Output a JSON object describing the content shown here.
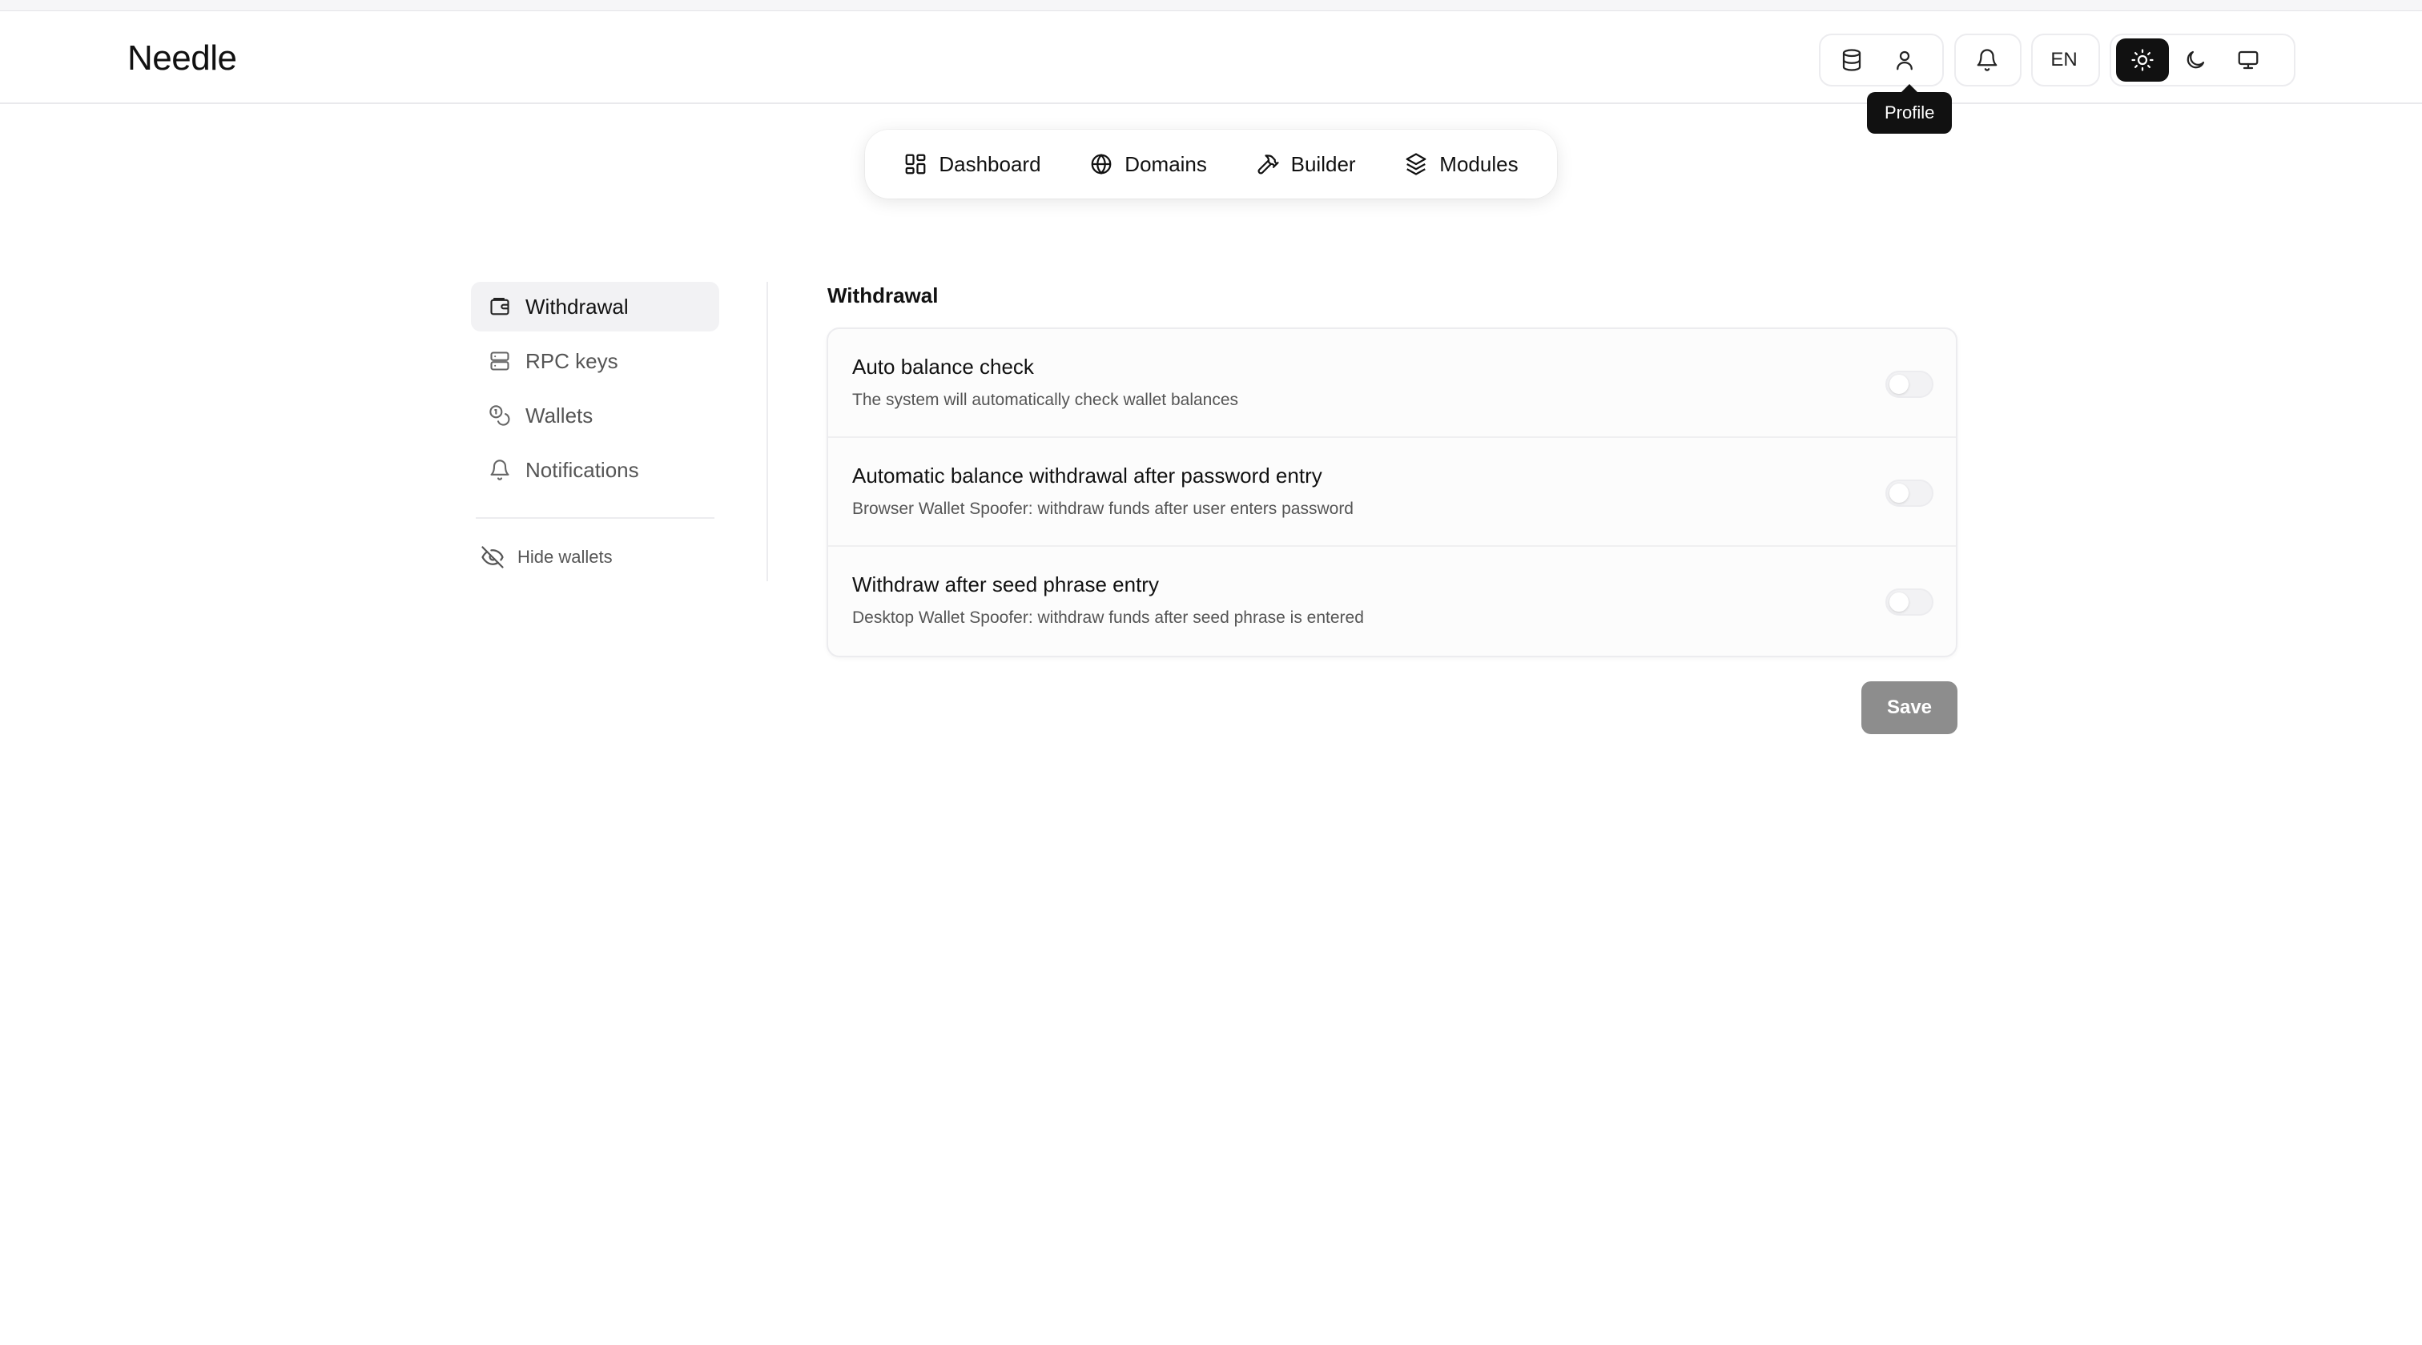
{
  "app": {
    "title": "Needle"
  },
  "header": {
    "language": "EN",
    "tooltip": "Profile"
  },
  "nav": [
    {
      "label": "Dashboard",
      "icon": "dashboard-icon"
    },
    {
      "label": "Domains",
      "icon": "globe-icon"
    },
    {
      "label": "Builder",
      "icon": "hammer-icon"
    },
    {
      "label": "Modules",
      "icon": "layers-icon"
    }
  ],
  "sidebar": {
    "items": [
      {
        "label": "Withdrawal",
        "icon": "wallet-icon",
        "active": true
      },
      {
        "label": "RPC keys",
        "icon": "server-icon"
      },
      {
        "label": "Wallets",
        "icon": "coins-icon"
      },
      {
        "label": "Notifications",
        "icon": "bell-icon"
      }
    ],
    "hide_wallets": "Hide wallets"
  },
  "main": {
    "title": "Withdrawal",
    "settings": [
      {
        "title": "Auto balance check",
        "description": "The system will automatically check wallet balances",
        "enabled": false
      },
      {
        "title": "Automatic balance withdrawal after password entry",
        "description": "Browser Wallet Spoofer: withdraw funds after user enters password",
        "enabled": false
      },
      {
        "title": "Withdraw after seed phrase entry",
        "description": "Desktop Wallet Spoofer: withdraw funds after seed phrase is entered",
        "enabled": false
      }
    ],
    "save_label": "Save"
  },
  "colors": {
    "accent": "#111111",
    "save_disabled": "#8d8d8d",
    "border": "#ececef"
  }
}
